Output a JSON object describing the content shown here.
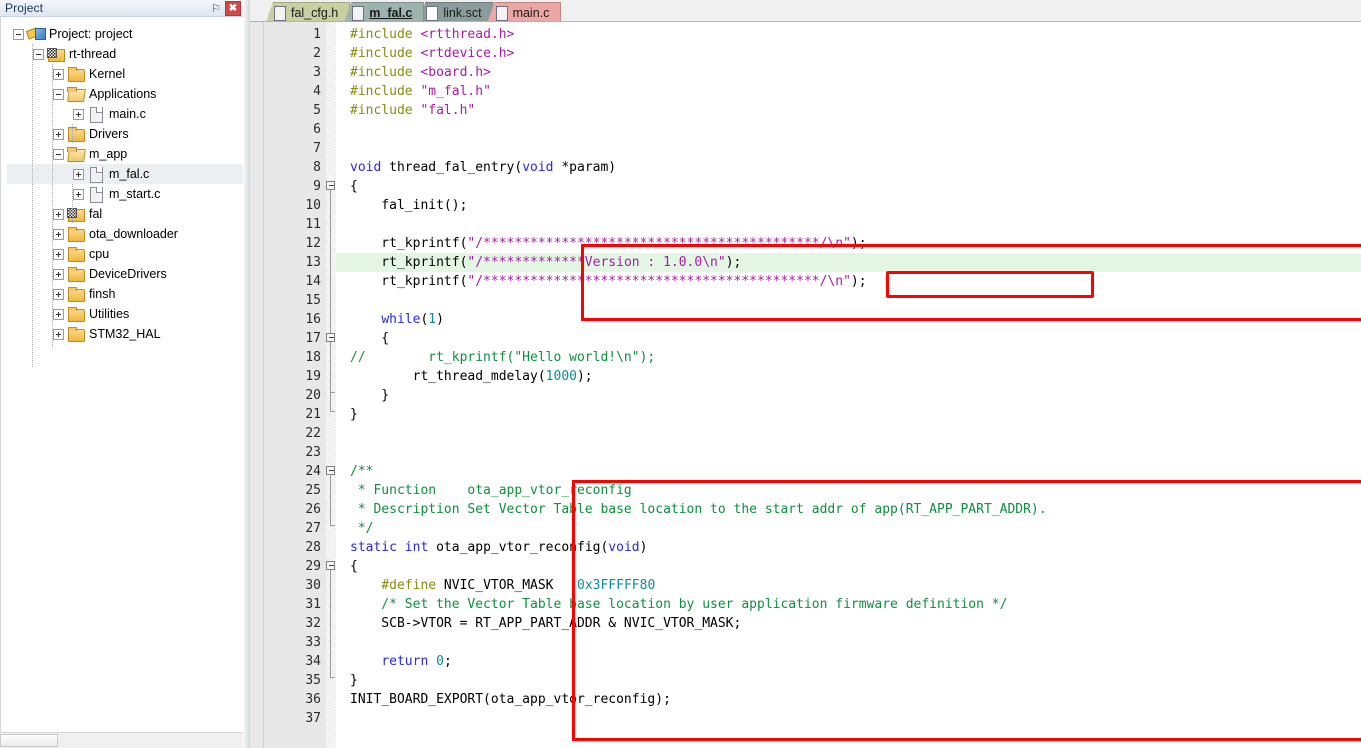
{
  "panel": {
    "title": "Project",
    "pin_icon": "pin-icon",
    "pin_glyph": "⚐",
    "close_icon": "close-icon",
    "close_glyph": "✖",
    "tree": [
      {
        "label": "Project: project",
        "depth": 0,
        "expander": "minus",
        "icon": "project-icon",
        "selected": false
      },
      {
        "label": "rt-thread",
        "depth": 1,
        "expander": "minus",
        "icon": "folder-checkered-icon",
        "selected": false
      },
      {
        "label": "Kernel",
        "depth": 2,
        "expander": "plus",
        "icon": "folder-icon",
        "selected": false
      },
      {
        "label": "Applications",
        "depth": 2,
        "expander": "minus",
        "icon": "folder-open-icon",
        "selected": false
      },
      {
        "label": "main.c",
        "depth": 3,
        "expander": "plus",
        "icon": "file-icon",
        "selected": false
      },
      {
        "label": "Drivers",
        "depth": 2,
        "expander": "plus",
        "icon": "folder-icon",
        "selected": false
      },
      {
        "label": "m_app",
        "depth": 2,
        "expander": "minus",
        "icon": "folder-open-icon",
        "selected": false
      },
      {
        "label": "m_fal.c",
        "depth": 3,
        "expander": "plus",
        "icon": "file-icon",
        "selected": true
      },
      {
        "label": "m_start.c",
        "depth": 3,
        "expander": "plus",
        "icon": "file-icon",
        "selected": false
      },
      {
        "label": "fal",
        "depth": 2,
        "expander": "plus",
        "icon": "folder-checkered-icon",
        "selected": false
      },
      {
        "label": "ota_downloader",
        "depth": 2,
        "expander": "plus",
        "icon": "folder-icon",
        "selected": false
      },
      {
        "label": "cpu",
        "depth": 2,
        "expander": "plus",
        "icon": "folder-icon",
        "selected": false
      },
      {
        "label": "DeviceDrivers",
        "depth": 2,
        "expander": "plus",
        "icon": "folder-icon",
        "selected": false
      },
      {
        "label": "finsh",
        "depth": 2,
        "expander": "plus",
        "icon": "folder-icon",
        "selected": false
      },
      {
        "label": "Utilities",
        "depth": 2,
        "expander": "plus",
        "icon": "folder-icon",
        "selected": false
      },
      {
        "label": "STM32_HAL",
        "depth": 2,
        "expander": "plus",
        "icon": "folder-icon",
        "selected": false
      }
    ]
  },
  "tabs": [
    {
      "label": "fal_cfg.h",
      "active": false,
      "bg": "#c8cfa0",
      "icon": "file-hatched-icon"
    },
    {
      "label": "m_fal.c",
      "active": true,
      "bg": "#9db3ae",
      "icon": "file-hatched-icon"
    },
    {
      "label": "link.sct",
      "active": false,
      "bg": "#8c9c9c",
      "icon": "file-plain-icon"
    },
    {
      "label": "main.c",
      "active": false,
      "bg": "#eca6a6",
      "icon": "file-hatched-icon"
    }
  ],
  "editor": {
    "current_line": 13,
    "first_line": 1,
    "last_line": 37,
    "lines": [
      {
        "n": 1,
        "tokens": [
          {
            "t": "#include ",
            "c": "pre"
          },
          {
            "t": "<rtthread.h>",
            "c": "hdr"
          }
        ]
      },
      {
        "n": 2,
        "tokens": [
          {
            "t": "#include ",
            "c": "pre"
          },
          {
            "t": "<rtdevice.h>",
            "c": "hdr"
          }
        ]
      },
      {
        "n": 3,
        "tokens": [
          {
            "t": "#include ",
            "c": "pre"
          },
          {
            "t": "<board.h>",
            "c": "hdr"
          }
        ]
      },
      {
        "n": 4,
        "tokens": [
          {
            "t": "#include ",
            "c": "pre"
          },
          {
            "t": "\"m_fal.h\"",
            "c": "str"
          }
        ]
      },
      {
        "n": 5,
        "tokens": [
          {
            "t": "#include ",
            "c": "pre"
          },
          {
            "t": "\"fal.h\"",
            "c": "str"
          }
        ]
      },
      {
        "n": 6,
        "tokens": []
      },
      {
        "n": 7,
        "tokens": []
      },
      {
        "n": 8,
        "tokens": [
          {
            "t": "void",
            "c": "kw"
          },
          {
            "t": " thread_fal_entry(",
            "c": "pln"
          },
          {
            "t": "void",
            "c": "kw"
          },
          {
            "t": " *param)",
            "c": "pln"
          }
        ]
      },
      {
        "n": 9,
        "tokens": [
          {
            "t": "{",
            "c": "pln"
          }
        ]
      },
      {
        "n": 10,
        "tokens": [
          {
            "t": "    fal_init();",
            "c": "pln"
          }
        ]
      },
      {
        "n": 11,
        "tokens": []
      },
      {
        "n": 12,
        "tokens": [
          {
            "t": "    rt_kprintf(",
            "c": "pln"
          },
          {
            "t": "\"/*******************************************/\\n\"",
            "c": "str"
          },
          {
            "t": ");",
            "c": "pln"
          }
        ]
      },
      {
        "n": 13,
        "tokens": [
          {
            "t": "    rt_kprintf(",
            "c": "pln"
          },
          {
            "t": "\"/*************Version : 1.0.0\\n\"",
            "c": "str"
          },
          {
            "t": ");",
            "c": "pln"
          }
        ]
      },
      {
        "n": 14,
        "tokens": [
          {
            "t": "    rt_kprintf(",
            "c": "pln"
          },
          {
            "t": "\"/*******************************************/\\n\"",
            "c": "str"
          },
          {
            "t": ");",
            "c": "pln"
          }
        ]
      },
      {
        "n": 15,
        "tokens": []
      },
      {
        "n": 16,
        "tokens": [
          {
            "t": "    ",
            "c": "pln"
          },
          {
            "t": "while",
            "c": "kw"
          },
          {
            "t": "(",
            "c": "pln"
          },
          {
            "t": "1",
            "c": "num"
          },
          {
            "t": ")",
            "c": "pln"
          }
        ]
      },
      {
        "n": 17,
        "tokens": [
          {
            "t": "    {",
            "c": "pln"
          }
        ]
      },
      {
        "n": 18,
        "tokens": [
          {
            "t": "//        rt_kprintf(\"Hello world!\\n\");",
            "c": "cmt"
          }
        ]
      },
      {
        "n": 19,
        "tokens": [
          {
            "t": "        rt_thread_mdelay(",
            "c": "pln"
          },
          {
            "t": "1000",
            "c": "num"
          },
          {
            "t": ");",
            "c": "pln"
          }
        ]
      },
      {
        "n": 20,
        "tokens": [
          {
            "t": "    }",
            "c": "pln"
          }
        ]
      },
      {
        "n": 21,
        "tokens": [
          {
            "t": "}",
            "c": "pln"
          }
        ]
      },
      {
        "n": 22,
        "tokens": []
      },
      {
        "n": 23,
        "tokens": []
      },
      {
        "n": 24,
        "tokens": [
          {
            "t": "/**",
            "c": "cmt"
          }
        ]
      },
      {
        "n": 25,
        "tokens": [
          {
            "t": " * Function    ota_app_vtor_reconfig",
            "c": "cmt"
          }
        ]
      },
      {
        "n": 26,
        "tokens": [
          {
            "t": " * Description Set Vector Table base location to the start addr of app(RT_APP_PART_ADDR).",
            "c": "cmt"
          }
        ]
      },
      {
        "n": 27,
        "tokens": [
          {
            "t": " */",
            "c": "cmt"
          }
        ]
      },
      {
        "n": 28,
        "tokens": [
          {
            "t": "static",
            "c": "kw"
          },
          {
            "t": " ",
            "c": "pln"
          },
          {
            "t": "int",
            "c": "kw"
          },
          {
            "t": " ota_app_vtor_reconfig(",
            "c": "pln"
          },
          {
            "t": "void",
            "c": "kw"
          },
          {
            "t": ")",
            "c": "pln"
          }
        ]
      },
      {
        "n": 29,
        "tokens": [
          {
            "t": "{",
            "c": "pln"
          }
        ]
      },
      {
        "n": 30,
        "tokens": [
          {
            "t": "    ",
            "c": "pln"
          },
          {
            "t": "#define",
            "c": "pre"
          },
          {
            "t": " NVIC_VTOR_MASK   ",
            "c": "pln"
          },
          {
            "t": "0x3FFFFF80",
            "c": "num"
          }
        ]
      },
      {
        "n": 31,
        "tokens": [
          {
            "t": "    /* Set the Vector Table base location by user application firmware definition */",
            "c": "cmt"
          }
        ]
      },
      {
        "n": 32,
        "tokens": [
          {
            "t": "    SCB->VTOR = RT_APP_PART_ADDR & NVIC_VTOR_MASK;",
            "c": "pln"
          }
        ]
      },
      {
        "n": 33,
        "tokens": []
      },
      {
        "n": 34,
        "tokens": [
          {
            "t": "    ",
            "c": "pln"
          },
          {
            "t": "return",
            "c": "kw"
          },
          {
            "t": " ",
            "c": "pln"
          },
          {
            "t": "0",
            "c": "num"
          },
          {
            "t": ";",
            "c": "pln"
          }
        ]
      },
      {
        "n": 35,
        "tokens": [
          {
            "t": "}",
            "c": "pln"
          }
        ]
      },
      {
        "n": 36,
        "tokens": [
          {
            "t": "INIT_BOARD_EXPORT(ota_app_vtor_reconfig);",
            "c": "pln"
          }
        ]
      },
      {
        "n": 37,
        "tokens": []
      }
    ],
    "fold_markers": [
      {
        "line": 9,
        "type": "collapse-box"
      },
      {
        "line": 17,
        "type": "collapse-box"
      },
      {
        "line": 24,
        "type": "collapse-box"
      },
      {
        "line": 29,
        "type": "collapse-box"
      }
    ],
    "annotations": [
      {
        "name": "version-print-block-highlight",
        "color": "#ff0000"
      },
      {
        "name": "vtor-reconfig-block-highlight",
        "color": "#ff0000"
      },
      {
        "name": "version-string-highlight",
        "color": "#ff0000"
      }
    ]
  },
  "colors": {
    "preprocessor": "#8a8a10",
    "string": "#a81ba8",
    "keyword": "#2a2ae0",
    "number": "#0b8d9b",
    "comment": "#0f8f3f",
    "annotation": "#ff0000",
    "current_line_bg": "#e3f6e3"
  }
}
